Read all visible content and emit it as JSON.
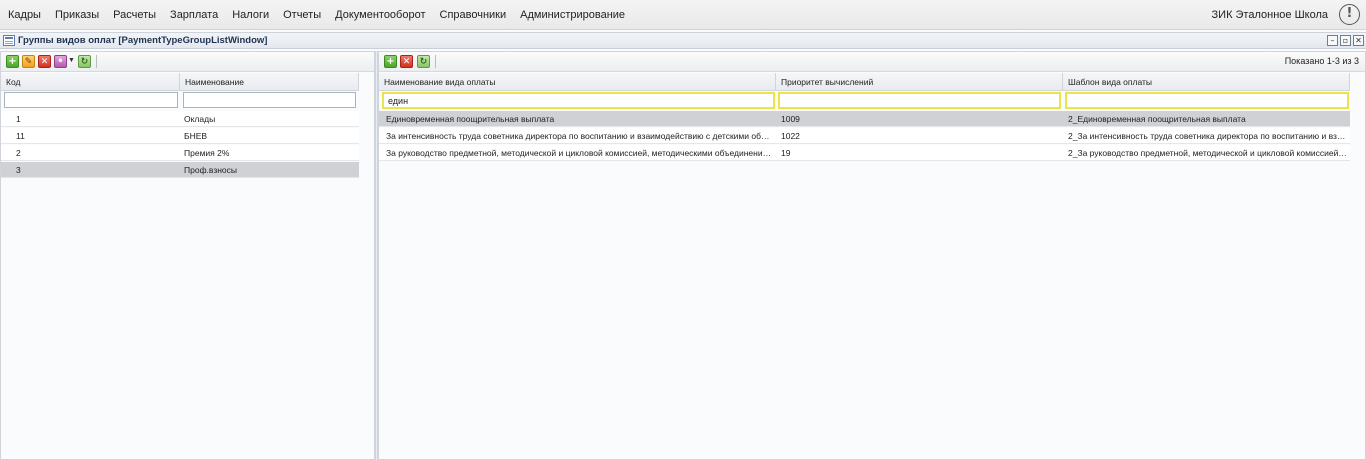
{
  "menu": {
    "items": [
      {
        "label": "Кадры"
      },
      {
        "label": "Приказы"
      },
      {
        "label": "Расчеты"
      },
      {
        "label": "Зарплата"
      },
      {
        "label": "Налоги"
      },
      {
        "label": "Отчеты"
      },
      {
        "label": "Документооборот"
      },
      {
        "label": "Справочники"
      },
      {
        "label": "Администрирование"
      }
    ],
    "org_name": "ЗИК Эталонное Школа",
    "alert_icon": "!"
  },
  "window": {
    "title": "Группы видов оплат [PaymentTypeGroupListWindow]",
    "controls": {
      "minimize": "–",
      "restore": "▫",
      "close": "✕"
    }
  },
  "left_panel": {
    "toolbar_icons": [
      "add-icon",
      "edit-icon",
      "delete-icon",
      "more-icon",
      "refresh-icon"
    ],
    "columns": [
      "Код",
      "Наименование"
    ],
    "filters": [
      "",
      ""
    ],
    "rows": [
      {
        "code": "1",
        "name": "Оклады",
        "selected": false
      },
      {
        "code": "11",
        "name": "БНЕВ",
        "selected": false
      },
      {
        "code": "2",
        "name": "Премия 2%",
        "selected": false
      },
      {
        "code": "3",
        "name": "Проф.взносы",
        "selected": true
      }
    ]
  },
  "right_panel": {
    "toolbar_icons": [
      "add-icon",
      "delete-icon",
      "refresh-icon"
    ],
    "shown_text": "Показано 1-3 из 3",
    "columns": [
      "Наименование вида оплаты",
      "Приоритет вычислений",
      "Шаблон вида оплаты"
    ],
    "filters": [
      "един",
      "",
      ""
    ],
    "rows": [
      {
        "name": "Единовременная поощрительная выплата",
        "priority": "1009",
        "template": "2_Единовременная поощрительная выплата",
        "selected": true
      },
      {
        "name": "За интенсивность труда советника директора по воспитанию и взаимодействию с детскими общес...",
        "priority": "1022",
        "template": "2_За интенсивность труда советника директора по воспитанию и взаи...",
        "selected": false
      },
      {
        "name": "За руководство предметной, методической и цикловой комиссией, методическими объединениями",
        "priority": "19",
        "template": "2_За руководство предметной, методической и цикловой комиссией, м...",
        "selected": false
      }
    ]
  },
  "colors": {
    "selected_row": "#cfd1d5",
    "filter_highlight": "#ece34a"
  }
}
